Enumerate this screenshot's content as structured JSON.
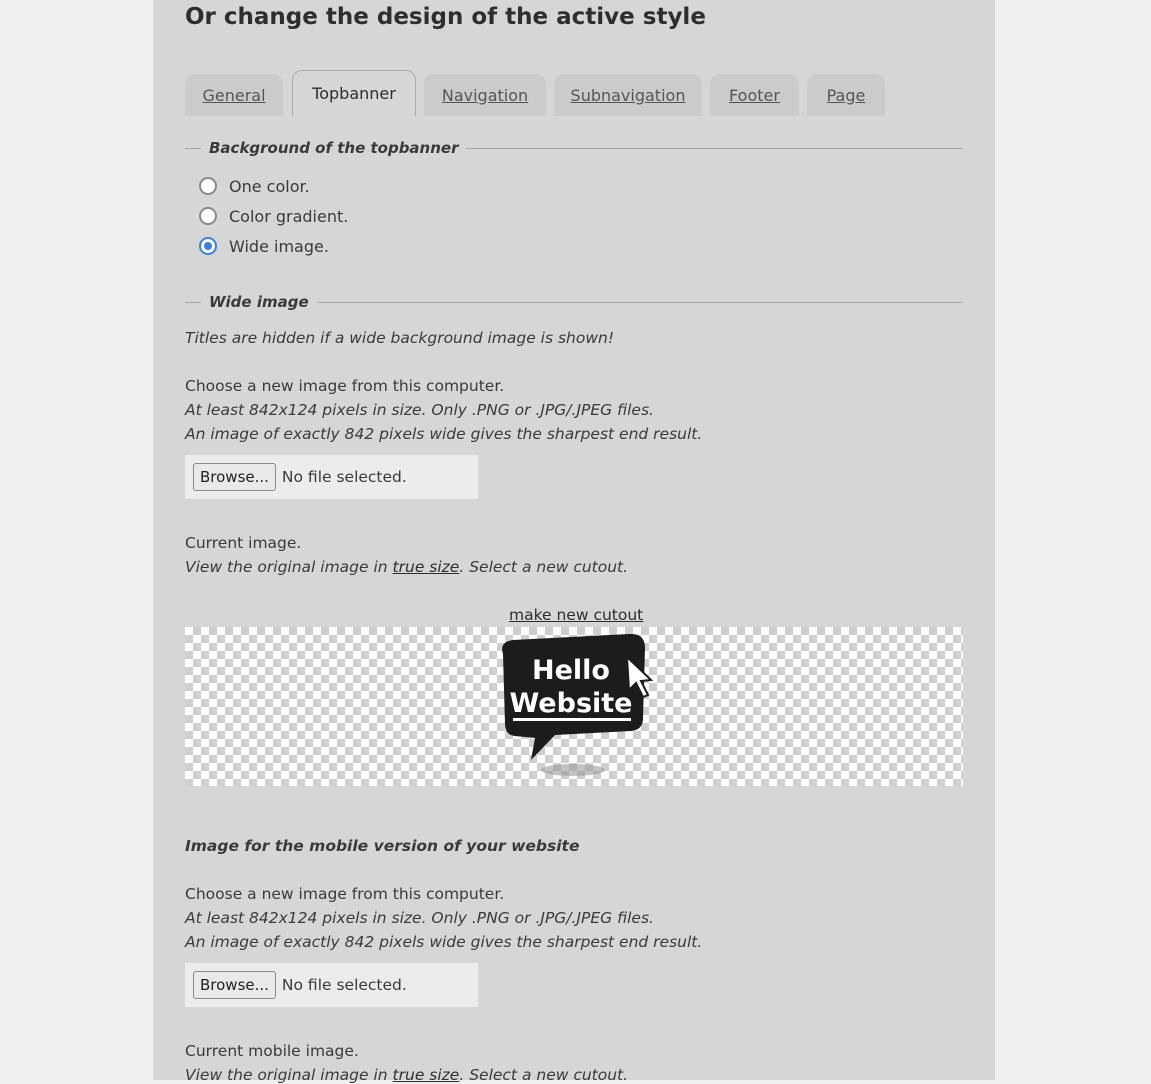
{
  "heading": "Or change the design of the active style",
  "tabs": [
    {
      "label": "General"
    },
    {
      "label": "Topbanner"
    },
    {
      "label": "Navigation"
    },
    {
      "label": "Subnavigation"
    },
    {
      "label": "Footer"
    },
    {
      "label": "Page"
    }
  ],
  "active_tab": "Topbanner",
  "background_section": {
    "legend": "Background of the topbanner",
    "options": [
      {
        "label": "One color.",
        "checked": false
      },
      {
        "label": "Color gradient.",
        "checked": false
      },
      {
        "label": "Wide image.",
        "checked": true
      }
    ]
  },
  "wide_image": {
    "legend": "Wide image",
    "notice": "Titles are hidden if a wide background image is shown!",
    "choose_label": "Choose a new image from this computer.",
    "size_hint": "At least 842x124 pixels in size. Only .PNG or .JPG/.JPEG files.",
    "sharp_hint": "An image of exactly 842 pixels wide gives the sharpest end result.",
    "browse_label": "Browse...",
    "no_file": "No file selected.",
    "current_label": "Current image.",
    "view_prefix": "View the original image in ",
    "true_size_link": "true size",
    "view_suffix": ". Select a new cutout.",
    "cutout_link": "make new cutout",
    "logo_line1": "Hello",
    "logo_line2": "Website"
  },
  "mobile": {
    "heading": "Image for the mobile version of your website",
    "choose_label": "Choose a new image from this computer.",
    "size_hint": "At least 842x124 pixels in size. Only .PNG or .JPG/.JPEG files.",
    "sharp_hint": "An image of exactly 842 pixels wide gives the sharpest end result.",
    "browse_label": "Browse...",
    "no_file": "No file selected.",
    "current_label": "Current mobile image.",
    "view_prefix": "View the original image in ",
    "true_size_link": "true size",
    "view_suffix": ". Select a new cutout."
  },
  "colors": {
    "page_bg": "#efefef",
    "panel_bg": "#d6d6d6",
    "radio_accent": "#3b7fd6"
  }
}
